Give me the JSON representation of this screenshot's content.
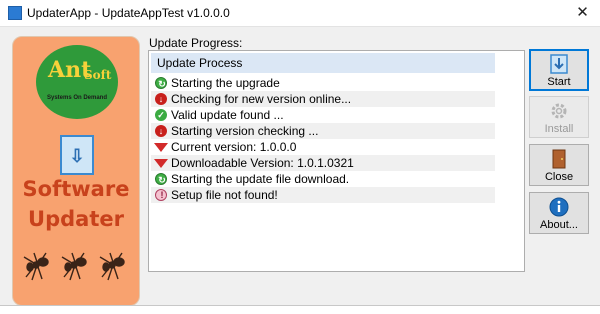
{
  "window": {
    "title": "UpdaterApp - UpdateAppTest v1.0.0.0",
    "close_glyph": "✕",
    "app_icon": "app-icon"
  },
  "banner": {
    "logo_ant": "Ant",
    "logo_soft": "Soft",
    "logo_tagline": "Systems On Demand",
    "title_line1": "Software",
    "title_line2": "Updater",
    "update_icon": "document-download-icon",
    "ant_icons": [
      "ant-icon",
      "ant-icon",
      "ant-icon"
    ]
  },
  "progress": {
    "label": "Update Progress:",
    "column_header": "Update Process",
    "rows": [
      {
        "icon": "spinner-icon",
        "kind": "spin",
        "text": "Starting the upgrade"
      },
      {
        "icon": "download-arrow-icon",
        "kind": "down",
        "text": "Checking for new version online..."
      },
      {
        "icon": "check-icon",
        "kind": "check",
        "text": "Valid update found ..."
      },
      {
        "icon": "download-arrow-icon",
        "kind": "down",
        "text": "Starting version checking ..."
      },
      {
        "icon": "gem-icon",
        "kind": "gem",
        "text": "Current version: 1.0.0.0"
      },
      {
        "icon": "gem-icon",
        "kind": "gem",
        "text": "Downloadable Version: 1.0.1.0321"
      },
      {
        "icon": "spinner-icon",
        "kind": "spin",
        "text": "Starting the update file download."
      },
      {
        "icon": "error-icon",
        "kind": "err",
        "text": "Setup file not found!"
      }
    ]
  },
  "buttons": {
    "start": "Start",
    "install": "Install",
    "close": "Close",
    "about": "About..."
  },
  "colors": {
    "banner_bg": "#f8a26f",
    "banner_title": "#c8421c",
    "logo_bg": "#2f9a3a",
    "list_header_bg": "#dbe7f5",
    "accent": "#0078d7"
  }
}
